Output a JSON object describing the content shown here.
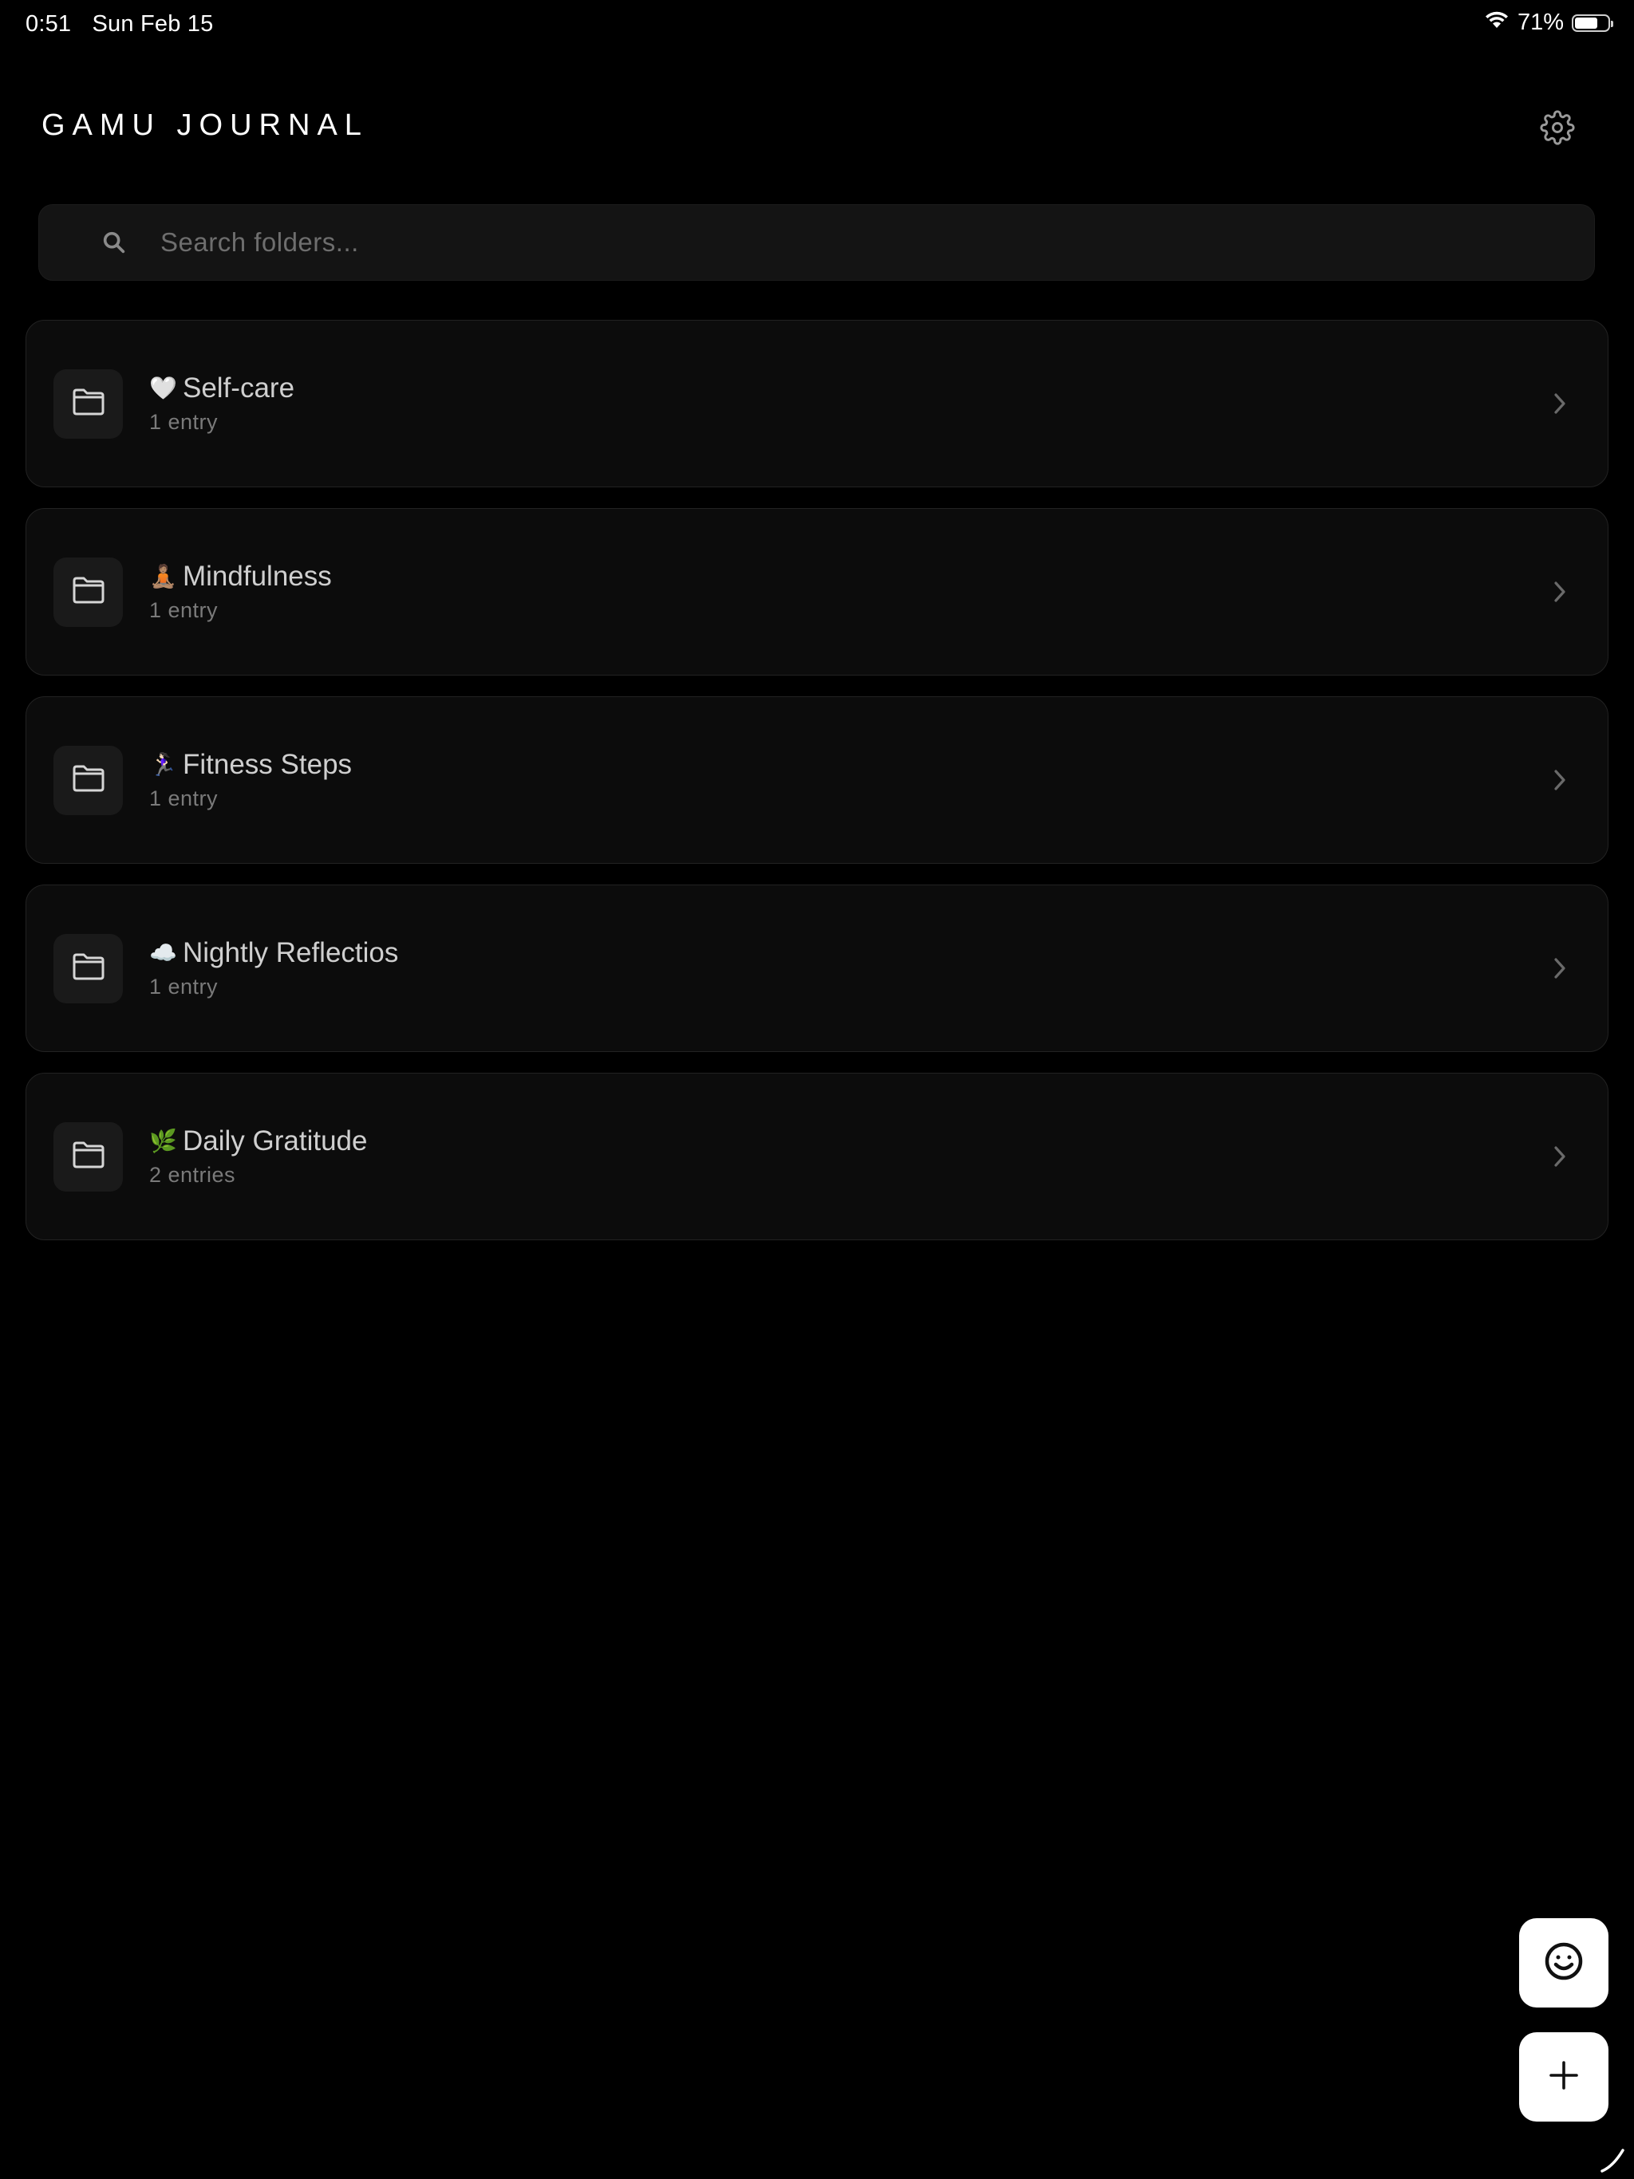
{
  "status_bar": {
    "time": "0:51",
    "date": "Sun Feb 15",
    "battery_text": "71%",
    "battery_level": 0.71
  },
  "header": {
    "title": "GAMU JOURNAL",
    "settings_icon": "gear-icon"
  },
  "search": {
    "placeholder": "Search folders...",
    "value": ""
  },
  "folders": [
    {
      "emoji": "🤍",
      "name": "Self-care",
      "count": "1 entry"
    },
    {
      "emoji": "🧘🏽",
      "name": "Mindfulness",
      "count": "1 entry"
    },
    {
      "emoji": "🏃🏻‍♀️",
      "name": "Fitness Steps",
      "count": "1 entry"
    },
    {
      "emoji": "☁️",
      "name": "Nightly Reflectios",
      "count": "1 entry"
    },
    {
      "emoji": "🌿",
      "name": "Daily Gratitude",
      "count": "2 entries"
    }
  ],
  "fabs": {
    "mood_icon": "smiley-icon",
    "add_icon": "plus-icon"
  },
  "colors": {
    "background": "#000000",
    "card": "#0c0c0c",
    "card_border": "#222222",
    "text_primary": "#cfcfcf",
    "text_secondary": "#7a7a7a",
    "fab": "#ffffff"
  }
}
